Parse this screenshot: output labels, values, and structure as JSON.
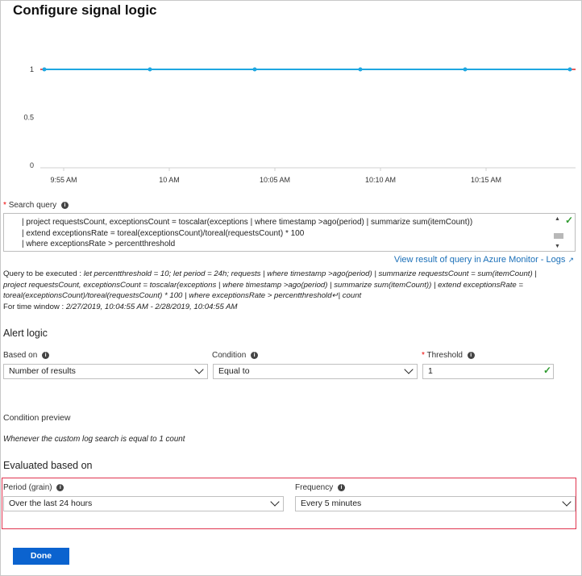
{
  "title": "Configure signal logic",
  "chart_data": {
    "type": "line",
    "x": [
      "9:52 AM",
      "9:57 AM",
      "10:02 AM",
      "10:07 AM",
      "10:12 AM",
      "10:17 AM"
    ],
    "tick_labels": [
      "9:55 AM",
      "10 AM",
      "10:05 AM",
      "10:10 AM",
      "10:15 AM"
    ],
    "y_ticks": [
      "1",
      "0.5",
      "0"
    ],
    "series": [
      {
        "values": [
          1,
          1,
          1,
          1,
          1,
          1
        ]
      }
    ],
    "threshold": 1,
    "ylim": [
      0,
      1
    ],
    "line_color": "#1ea7e1",
    "threshold_color": "#e02020",
    "grid": false
  },
  "query": {
    "label": "Search query",
    "lines": [
      "| project requestsCount, exceptionsCount = toscalar(exceptions | where timestamp >ago(period) | summarize sum(itemCount))",
      "| extend exceptionsRate = toreal(exceptionsCount)/toreal(requestsCount) * 100",
      "| where exceptionsRate > percentthreshold"
    ],
    "view_link": "View result of query in Azure Monitor - Logs"
  },
  "exec": {
    "prefix": "Query to be executed : ",
    "line1": "let percentthreshold = 10; let period = 24h; requests | where timestamp >ago(period) | summarize requestsCount = sum(itemCount) |",
    "line2": "project requestsCount, exceptionsCount = toscalar(exceptions | where timestamp >ago(period) | summarize sum(itemCount)) | extend exceptionsRate =",
    "line3": "toreal(exceptionsCount)/toreal(requestsCount) * 100 | where exceptionsRate > percentthreshold↵| count",
    "window_prefix": "For time window : ",
    "window": "2/27/2019, 10:04:55 AM - 2/28/2019, 10:04:55 AM"
  },
  "alert": {
    "heading": "Alert logic",
    "based_on_label": "Based on",
    "based_on_value": "Number of results",
    "condition_label": "Condition",
    "condition_value": "Equal to",
    "threshold_label": "Threshold",
    "threshold_value": "1"
  },
  "preview": {
    "label": "Condition preview",
    "text": "Whenever the custom log search is equal to 1 count"
  },
  "evaluated": {
    "heading": "Evaluated based on",
    "period_label": "Period (grain)",
    "period_value": "Over the last 24 hours",
    "frequency_label": "Frequency",
    "frequency_value": "Every 5 minutes"
  },
  "done_label": "Done",
  "icons": {
    "info": "info-icon",
    "check": "checkmark-icon",
    "dropdown": "chevron-down-icon",
    "external": "external-link-icon"
  }
}
